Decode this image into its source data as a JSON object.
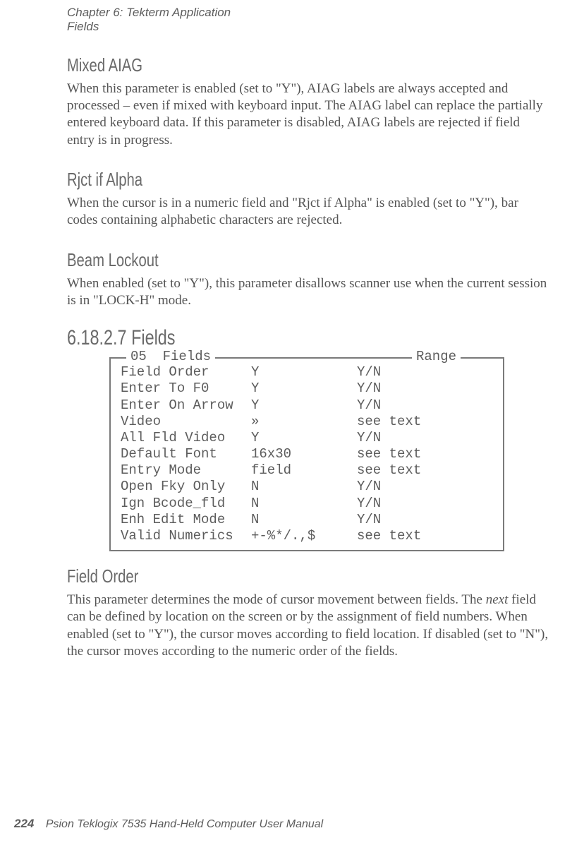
{
  "header": {
    "chapter_line": "Chapter 6: Tekterm Application",
    "section_line": "Fields"
  },
  "sections": {
    "mixed_aiag": {
      "title": "Mixed AIAG",
      "body": "When this parameter is enabled (set to \"Y\"), AIAG labels are always accepted and processed – even if mixed with keyboard input. The AIAG label can replace the partially entered keyboard data. If this parameter is disabled, AIAG labels are rejected if field entry is in progress."
    },
    "rjct_if_alpha": {
      "title": "Rjct if Alpha",
      "body": "When the cursor is in a numeric field and \"Rjct if Alpha\" is enabled (set to \"Y\"), bar codes containing alphabetic characters are rejected."
    },
    "beam_lockout": {
      "title": "Beam Lockout",
      "body": "When enabled (set to \"Y\"), this parameter disallows scanner use when the current session is in \"LOCK-H\" mode."
    },
    "fields_heading": "6.18.2.7 Fields",
    "field_order": {
      "title": "Field Order",
      "body_pre": "This parameter determines the mode of cursor movement between fields. The ",
      "body_em": "next",
      "body_post": " field can be defined by location on the screen or by the assignment of field numbers. When enabled (set to \"Y\"), the cursor moves according to field location. If disabled (set to \"N\"), the cursor moves according to the numeric order of the fields."
    }
  },
  "panel": {
    "legend_left_num": "05",
    "legend_left_title": "Fields",
    "legend_right": "Range",
    "rows": [
      {
        "name": "Field Order",
        "value": "Y",
        "range": "Y/N"
      },
      {
        "name": "Enter To F0",
        "value": "Y",
        "range": "Y/N"
      },
      {
        "name": "Enter On Arrow",
        "value": "Y",
        "range": "Y/N"
      },
      {
        "name": "Video",
        "value": "»",
        "range": "see text"
      },
      {
        "name": "All Fld Video",
        "value": "Y",
        "range": "Y/N"
      },
      {
        "name": "Default Font",
        "value": "16x30",
        "range": "see text"
      },
      {
        "name": "Entry Mode",
        "value": "field",
        "range": "see text"
      },
      {
        "name": "Open Fky Only",
        "value": "N",
        "range": "Y/N"
      },
      {
        "name": "Ign Bcode_fld",
        "value": "N",
        "range": "Y/N"
      },
      {
        "name": "Enh Edit Mode",
        "value": "N",
        "range": "Y/N"
      },
      {
        "name": "Valid Numerics",
        "value": "+-%*/.,$",
        "range": "see text"
      }
    ]
  },
  "footer": {
    "page_number": "224",
    "manual_title": "Psion Teklogix 7535 Hand-Held Computer User Manual"
  }
}
